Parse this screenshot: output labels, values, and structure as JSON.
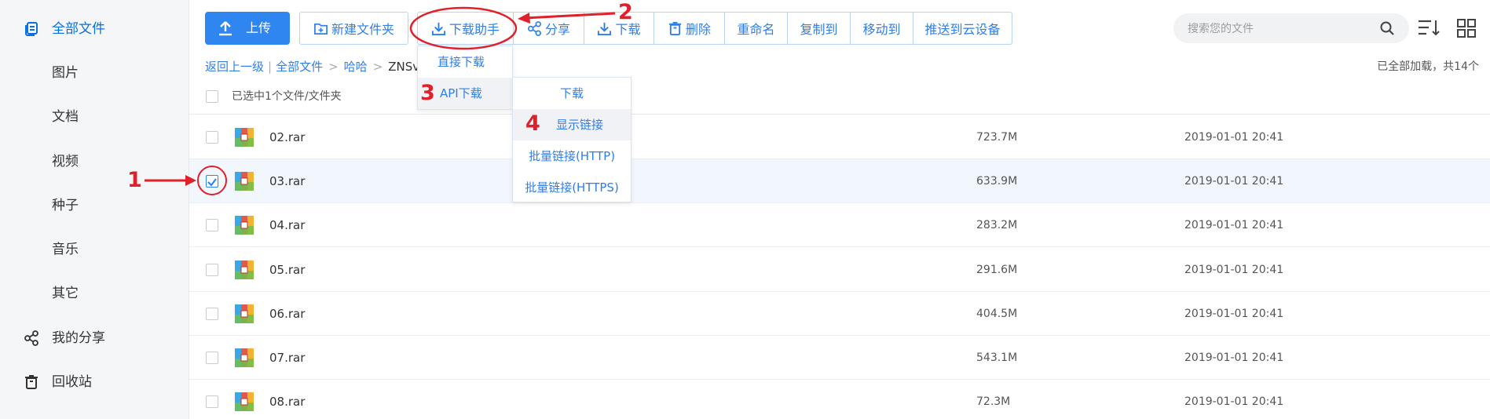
{
  "sidebar": {
    "items": [
      {
        "label": "全部文件",
        "icon": "files-icon"
      },
      {
        "label": "图片"
      },
      {
        "label": "文档"
      },
      {
        "label": "视频"
      },
      {
        "label": "种子"
      },
      {
        "label": "音乐"
      },
      {
        "label": "其它"
      },
      {
        "label": "我的分享",
        "icon": "share-icon"
      },
      {
        "label": "回收站",
        "icon": "trash-icon"
      }
    ]
  },
  "toolbar": {
    "upload_label": "上传",
    "new_folder_label": "新建文件夹",
    "download_helper_label": "下载助手",
    "share_label": "分享",
    "download_label": "下载",
    "delete_label": "删除",
    "rename_label": "重命名",
    "copy_to_label": "复制到",
    "move_to_label": "移动到",
    "push_label": "推送到云设备"
  },
  "search": {
    "placeholder": "搜索您的文件"
  },
  "breadcrumb": {
    "back": "返回上一级",
    "all_files": "全部文件",
    "folder": "哈哈",
    "current": "ZNSvu"
  },
  "status": {
    "loaded": "已全部加载，共14个",
    "selected": "已选中1个文件/文件夹"
  },
  "files": [
    {
      "name": "02.rar",
      "size": "723.7M",
      "date": "2019-01-01 20:41"
    },
    {
      "name": "03.rar",
      "size": "633.9M",
      "date": "2019-01-01 20:41"
    },
    {
      "name": "04.rar",
      "size": "283.2M",
      "date": "2019-01-01 20:41"
    },
    {
      "name": "05.rar",
      "size": "291.6M",
      "date": "2019-01-01 20:41"
    },
    {
      "name": "06.rar",
      "size": "404.5M",
      "date": "2019-01-01 20:41"
    },
    {
      "name": "07.rar",
      "size": "543.1M",
      "date": "2019-01-01 20:41"
    },
    {
      "name": "08.rar",
      "size": "72.3M",
      "date": "2019-01-01 20:41"
    }
  ],
  "download_menu": {
    "direct": "直接下载",
    "api": "API下载"
  },
  "api_menu": {
    "download": "下载",
    "show_link": "显示链接",
    "batch_http": "批量链接(HTTP)",
    "batch_https": "批量链接(HTTPS)"
  },
  "annotations": {
    "n1": "1",
    "n2": "2",
    "n3": "3",
    "n4": "4"
  },
  "colors": {
    "accent": "#2f86f0",
    "annotation": "#e0202a",
    "selected_row": "#f2f7fd"
  }
}
